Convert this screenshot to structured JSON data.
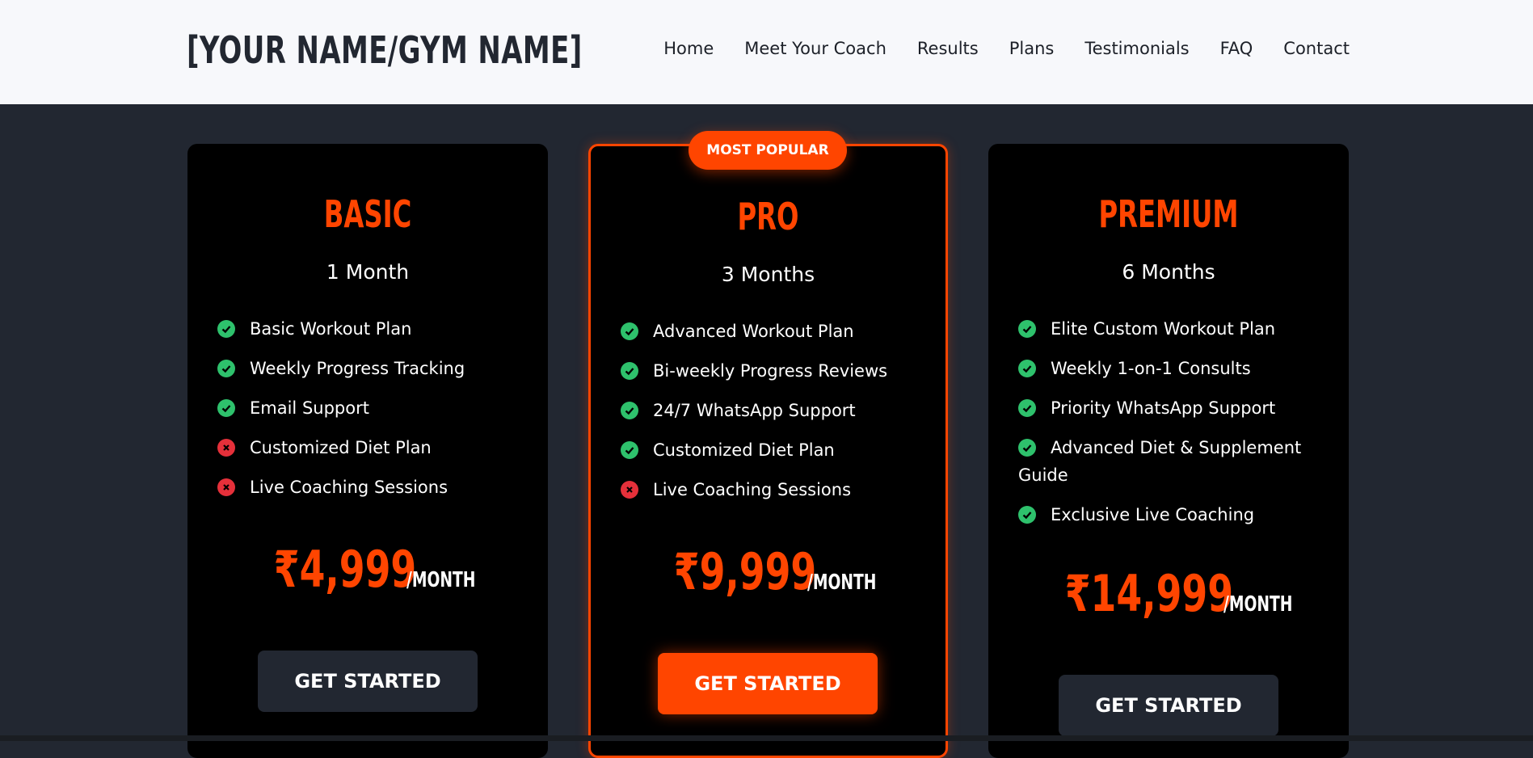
{
  "header": {
    "logo": "[YOUR NAME/GYM NAME]",
    "nav": [
      "Home",
      "Meet Your Coach",
      "Results",
      "Plans",
      "Testimonials",
      "FAQ",
      "Contact"
    ]
  },
  "colors": {
    "accent": "#ff4500",
    "background": "#222731",
    "card": "#000000",
    "check": "#2ec16c",
    "cross": "#e5303a"
  },
  "plans": [
    {
      "name": "BASIC",
      "duration": "1 Month",
      "features": [
        {
          "text": "Basic Workout Plan",
          "included": true
        },
        {
          "text": "Weekly Progress Tracking",
          "included": true
        },
        {
          "text": "Email Support",
          "included": true
        },
        {
          "text": "Customized Diet Plan",
          "included": false
        },
        {
          "text": "Live Coaching Sessions",
          "included": false
        }
      ],
      "price": "₹4,999",
      "period": "/MONTH",
      "cta": "GET STARTED"
    },
    {
      "badge": "MOST POPULAR",
      "name": "PRO",
      "duration": "3 Months",
      "features": [
        {
          "text": "Advanced Workout Plan",
          "included": true
        },
        {
          "text": "Bi-weekly Progress Reviews",
          "included": true
        },
        {
          "text": "24/7 WhatsApp Support",
          "included": true
        },
        {
          "text": "Customized Diet Plan",
          "included": true
        },
        {
          "text": "Live Coaching Sessions",
          "included": false
        }
      ],
      "price": "₹9,999",
      "period": "/MONTH",
      "cta": "GET STARTED"
    },
    {
      "name": "PREMIUM",
      "duration": "6 Months",
      "features": [
        {
          "text": "Elite Custom Workout Plan",
          "included": true
        },
        {
          "text": "Weekly 1-on-1 Consults",
          "included": true
        },
        {
          "text": "Priority WhatsApp Support",
          "included": true
        },
        {
          "text": "Advanced Diet & Supplement Guide",
          "included": true
        },
        {
          "text": "Exclusive Live Coaching",
          "included": true
        }
      ],
      "price": "₹14,999",
      "period": "/MONTH",
      "cta": "GET STARTED"
    }
  ]
}
